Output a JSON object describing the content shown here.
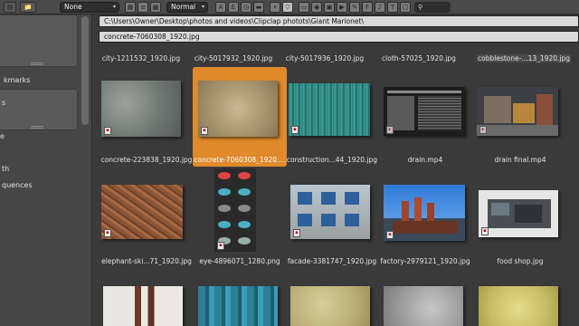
{
  "header": {
    "filter_select": "None",
    "display_select": "Normal"
  },
  "sidebar": {
    "labels": [
      "kmarks",
      "s",
      "e",
      "th",
      "quences"
    ]
  },
  "browser": {
    "directory": "C:\\Users\\Owner\\Desktop\\photos and videos\\Clipclap photots\\Giant Marionet\\",
    "filename": "concrete-7060308_1920.jpg"
  },
  "files": {
    "top_row": [
      "city-1211532_1920.jpg",
      "city-5017932_1920.jpg",
      "city-5017936_1920.jpg",
      "cloth-57025_1920.jpg",
      "cobblestone-...13_1920.jpg"
    ],
    "row1": [
      "concrete-223838_1920.jpg",
      "concrete-7060308_1920....",
      "construction...44_1920.jpg",
      "drain.mp4",
      "drain final.mp4"
    ],
    "row2": [
      "elephant-ski...71_1920.jpg",
      "eye-4896071_1280.png",
      "facade-3381747_1920.jpg",
      "factory-2979121_1920.jpg",
      "food shop.jpg"
    ],
    "selected_index": 1
  },
  "colors": {
    "selection": "#e08a2c",
    "panel_bg": "#3a3a3a"
  }
}
